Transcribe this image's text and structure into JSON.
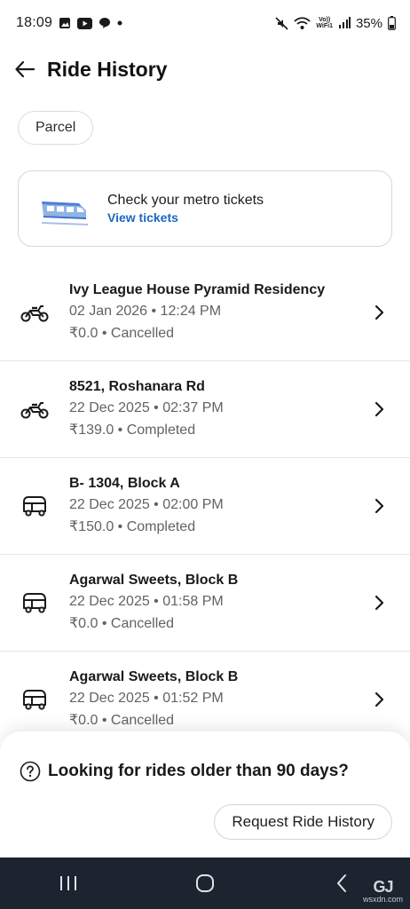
{
  "status_bar": {
    "time": "18:09",
    "battery": "35%",
    "volte_top": "Vo))",
    "volte_bottom": "WiFi1",
    "left_icons": [
      "gallery-icon",
      "youtube-icon",
      "app-icon",
      "dot-icon"
    ],
    "right_icons": [
      "mute-icon",
      "wifi-icon",
      "signal-icon",
      "battery-icon"
    ]
  },
  "header": {
    "title": "Ride History"
  },
  "filters": {
    "chip_label": "Parcel"
  },
  "metro": {
    "title": "Check your metro tickets",
    "link": "View tickets"
  },
  "rides": [
    {
      "place": "Ivy League House Pyramid Residency",
      "datetime": "02 Jan 2026 • 12:24 PM",
      "fare_status": "₹0.0 • Cancelled",
      "vehicle": "bike-icon"
    },
    {
      "place": "8521, Roshanara Rd",
      "datetime": "22 Dec 2025 • 02:37 PM",
      "fare_status": "₹139.0 • Completed",
      "vehicle": "bike-icon"
    },
    {
      "place": "B- 1304, Block A",
      "datetime": "22 Dec 2025 • 02:00 PM",
      "fare_status": "₹150.0 • Completed",
      "vehicle": "auto-rickshaw-icon"
    },
    {
      "place": "Agarwal Sweets, Block B",
      "datetime": "22 Dec 2025 • 01:58 PM",
      "fare_status": "₹0.0 • Cancelled",
      "vehicle": "auto-rickshaw-icon"
    },
    {
      "place": "Agarwal Sweets, Block B",
      "datetime": "22 Dec 2025 • 01:52 PM",
      "fare_status": "₹0.0 • Cancelled",
      "vehicle": "auto-rickshaw-icon"
    }
  ],
  "older_rides": {
    "question": "Looking for rides older than 90 days?",
    "button": "Request Ride History"
  },
  "watermark": {
    "logo": "GJ",
    "text": "wsxdn.com"
  },
  "colors": {
    "link": "#1c66c4",
    "nav_bar": "#1c2430",
    "text_primary": "#1a1a1a",
    "text_secondary": "#5f6368"
  }
}
